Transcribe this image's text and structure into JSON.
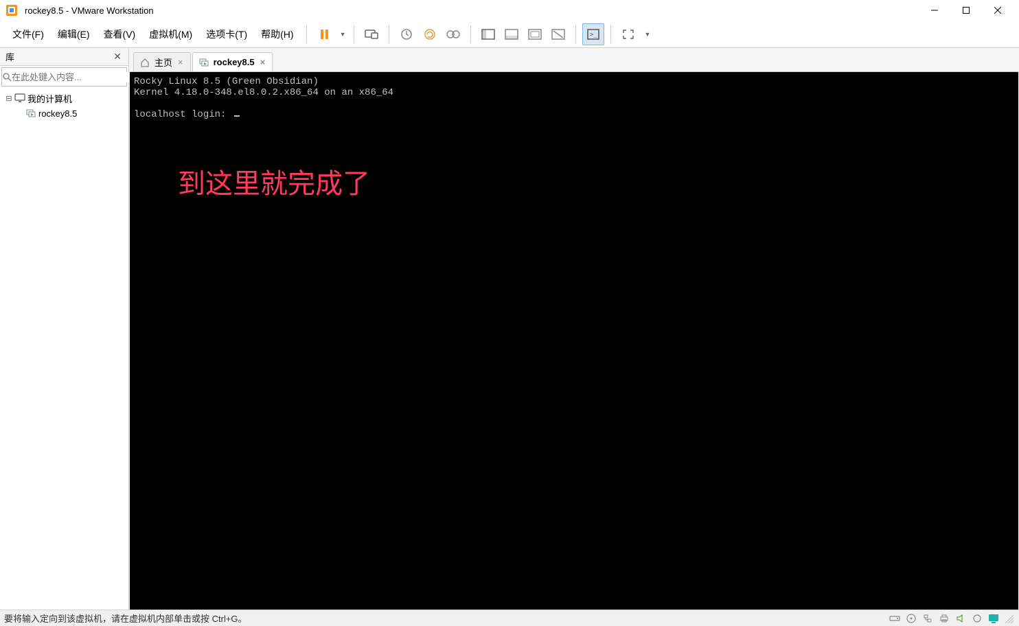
{
  "window": {
    "title": "rockey8.5 - VMware Workstation"
  },
  "menus": {
    "file": "文件(F)",
    "edit": "编辑(E)",
    "view": "查看(V)",
    "vm": "虚拟机(M)",
    "tabs": "选项卡(T)",
    "help": "帮助(H)"
  },
  "library": {
    "title": "库",
    "search_placeholder": "在此处键入内容...",
    "root": "我的计算机",
    "vm": "rockey8.5"
  },
  "tabs": {
    "home": "主页",
    "vm": "rockey8.5"
  },
  "console": {
    "line1": "Rocky Linux 8.5 (Green Obsidian)",
    "line2": "Kernel 4.18.0-348.el8.0.2.x86_64 on an x86_64",
    "line3": "localhost login: ",
    "annotation": "到这里就完成了"
  },
  "statusbar": {
    "text": "要将输入定向到该虚拟机，请在虚拟机内部单击或按 Ctrl+G。"
  }
}
